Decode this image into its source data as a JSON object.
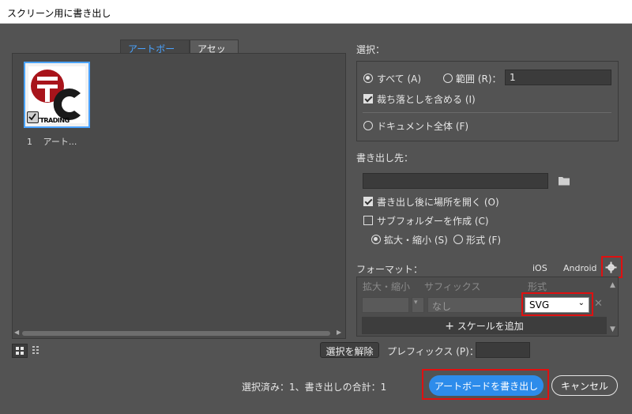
{
  "window": {
    "title": "スクリーン用に書き出し"
  },
  "tabs": [
    {
      "label": "アートボード",
      "active": true
    },
    {
      "label": "アセット",
      "active": false
    }
  ],
  "artboards": [
    {
      "index": "1",
      "name": "アート...",
      "caption": "RTTRADING",
      "checked": true
    }
  ],
  "select": {
    "heading": "選択：",
    "all_label": "すべて (A)",
    "range_label": "範囲 (R)：",
    "range_value": "1",
    "include_bleed_label": "裁ち落としを含める (I)",
    "whole_document_label": "ドキュメント全体 (F)"
  },
  "export_to": {
    "heading": "書き出し先：",
    "path_value": "",
    "open_after_label": "書き出し後に場所を開く (O)",
    "create_subfolder_label": "サブフォルダーを作成 (C)",
    "scale_label": "拡大・縮小 (S)",
    "format_label": "形式 (F)"
  },
  "formats": {
    "heading": "フォーマット：",
    "ios_label": "iOS",
    "android_label": "Android",
    "columns": [
      "拡大・縮小",
      "サフィックス",
      "形式"
    ],
    "row": {
      "suffix_value": "なし",
      "format_value": "SVG"
    },
    "add_scale_label": "スケールを追加"
  },
  "bottom": {
    "deselect_label": "選択を解除",
    "prefix_label": "プレフィックス (P)：",
    "prefix_value": "",
    "status_text": "選択済み：1、書き出しの合計：1",
    "export_button": "アートボードを書き出し",
    "cancel_button": "キャンセル"
  },
  "colors": {
    "background": "#535353",
    "accent": "#2d8ceb",
    "highlight": "#e01010",
    "logo_red": "#a8141b"
  }
}
